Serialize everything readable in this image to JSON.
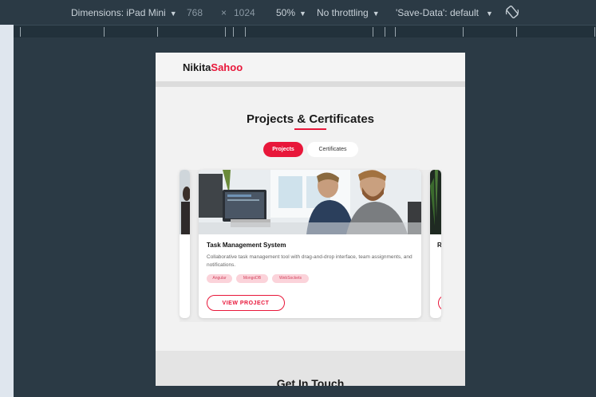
{
  "devtools": {
    "dimensions_label": "Dimensions: iPad Mini",
    "width": "768",
    "times": "×",
    "height": "1024",
    "zoom": "50%",
    "throttling": "No throttling",
    "save_data": "'Save-Data': default"
  },
  "site": {
    "logo_first": "Nikita",
    "logo_last": "Sahoo",
    "section_title": "Projects & Certificates",
    "tabs": [
      "Projects",
      "Certificates"
    ],
    "card": {
      "title": "Task Management System",
      "description": "Collaborative task management tool with drag-and-drop interface, team assignments, and notifications.",
      "tags": [
        "Angular",
        "MongoDB",
        "WebSockets"
      ],
      "button": "VIEW PROJECT"
    },
    "peek_card_title": "R",
    "contact_title": "Get In Touch"
  },
  "colors": {
    "accent": "#e8173a",
    "toolbar": "#2b3a45",
    "tag_bg": "#fbd3da"
  }
}
